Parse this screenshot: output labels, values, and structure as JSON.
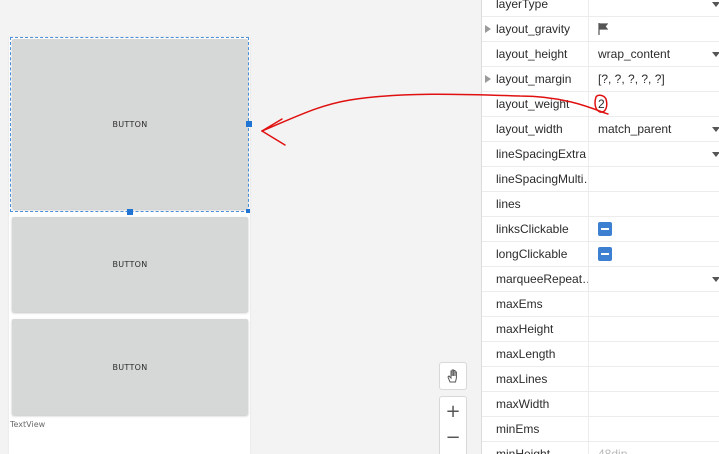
{
  "canvas": {
    "buttons": [
      {
        "label": "BUTTON"
      },
      {
        "label": "BUTTON"
      },
      {
        "label": "BUTTON"
      }
    ],
    "footer_label": "TextView",
    "tools": {
      "pan_icon": "hand-icon",
      "zoom_in_label": "+",
      "zoom_out_label": "−"
    }
  },
  "attributes": [
    {
      "name": "layerType",
      "value": "",
      "kind": "dropdown"
    },
    {
      "name": "layout_gravity",
      "value": "",
      "kind": "flag",
      "expandable": true
    },
    {
      "name": "layout_height",
      "value": "wrap_content",
      "kind": "dropdown"
    },
    {
      "name": "layout_margin",
      "value": "[?, ?, ?, ?, ?]",
      "kind": "text",
      "expandable": true
    },
    {
      "name": "layout_weight",
      "value": "2",
      "kind": "text"
    },
    {
      "name": "layout_width",
      "value": "match_parent",
      "kind": "dropdown"
    },
    {
      "name": "lineSpacingExtra",
      "value": "",
      "kind": "dropdown"
    },
    {
      "name": "lineSpacingMulti…",
      "value": "",
      "kind": "text"
    },
    {
      "name": "lines",
      "value": "",
      "kind": "text"
    },
    {
      "name": "linksClickable",
      "value": "",
      "kind": "toggle"
    },
    {
      "name": "longClickable",
      "value": "",
      "kind": "toggle"
    },
    {
      "name": "marqueeRepeat…",
      "value": "",
      "kind": "dropdown"
    },
    {
      "name": "maxEms",
      "value": "",
      "kind": "text"
    },
    {
      "name": "maxHeight",
      "value": "",
      "kind": "text"
    },
    {
      "name": "maxLength",
      "value": "",
      "kind": "text"
    },
    {
      "name": "maxLines",
      "value": "",
      "kind": "text"
    },
    {
      "name": "maxWidth",
      "value": "",
      "kind": "text"
    },
    {
      "name": "minEms",
      "value": "",
      "kind": "text"
    },
    {
      "name": "minHeight",
      "value": "48dip",
      "kind": "muted"
    }
  ],
  "colors": {
    "selection": "#1f74d4",
    "annotation": "#e01010",
    "toggle": "#3d7fd1"
  }
}
